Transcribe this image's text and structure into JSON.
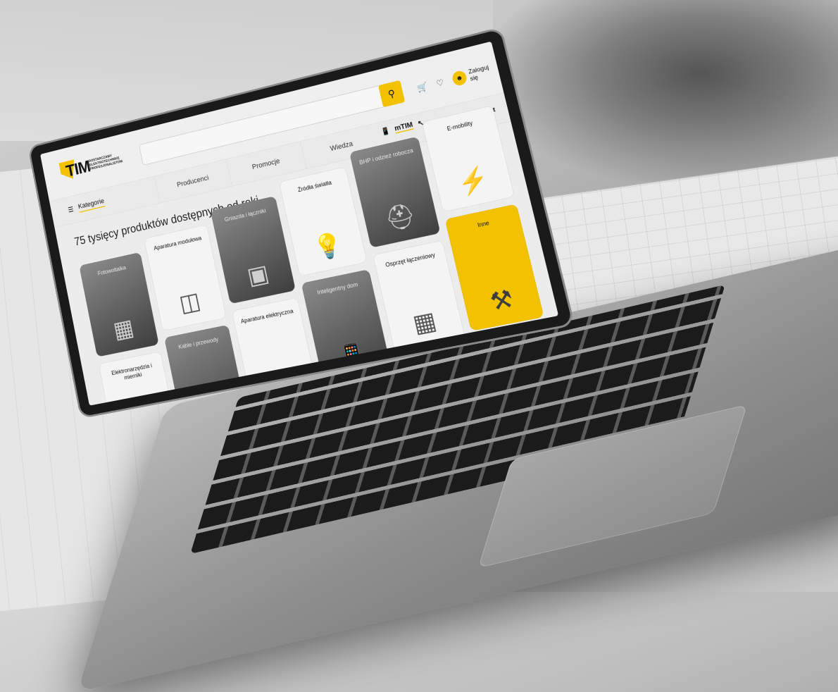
{
  "header": {
    "logo_text": "TIM",
    "logo_tagline": "Dostarczamy elektrotechnikę profesjonalistom",
    "search_icon": "search-icon",
    "cart_icon": "cart-icon",
    "heart_icon": "heart-icon",
    "login_label": "Zaloguj się"
  },
  "nav": {
    "categories_label": "Kategorie",
    "items": [
      "Producenci",
      "Promocje",
      "Wiedza"
    ],
    "mtim_label": "mTIM",
    "open_project_label": "Otwórz projekt"
  },
  "main": {
    "headline": "75 tysięcy produktów dostępnych od ręki",
    "tiles": [
      {
        "label": "Fotowoltaika",
        "icon": "solar-panel-icon",
        "style": "dark"
      },
      {
        "label": "Elektronarzędzia i mierniki",
        "icon": "drill-icon",
        "style": "light"
      },
      {
        "label": "Aparatura modułowa",
        "icon": "breaker-icon",
        "style": "light"
      },
      {
        "label": "Kable i przewody",
        "icon": "cable-icon",
        "style": "dark"
      },
      {
        "label": "Gniazda i łączniki",
        "icon": "socket-icon",
        "style": "dark"
      },
      {
        "label": "Aparatura elektryczna",
        "icon": "meter-icon",
        "style": "light"
      },
      {
        "label": "Źródła światła",
        "icon": "bulb-icon",
        "style": "light"
      },
      {
        "label": "Inteligentny dom",
        "icon": "phone-icon",
        "style": "dark"
      },
      {
        "label": "BHP i odzież robocza",
        "icon": "helmet-icon",
        "style": "dark"
      },
      {
        "label": "Osprzęt łączeniowy",
        "icon": "connector-box-icon",
        "style": "light"
      },
      {
        "label": "E-mobility",
        "icon": "ev-charger-icon",
        "style": "light"
      },
      {
        "label": "Inne",
        "icon": "tools-icon",
        "style": "yellow"
      }
    ]
  },
  "colors": {
    "accent": "#f2c200",
    "screen_bg": "#ececec"
  }
}
